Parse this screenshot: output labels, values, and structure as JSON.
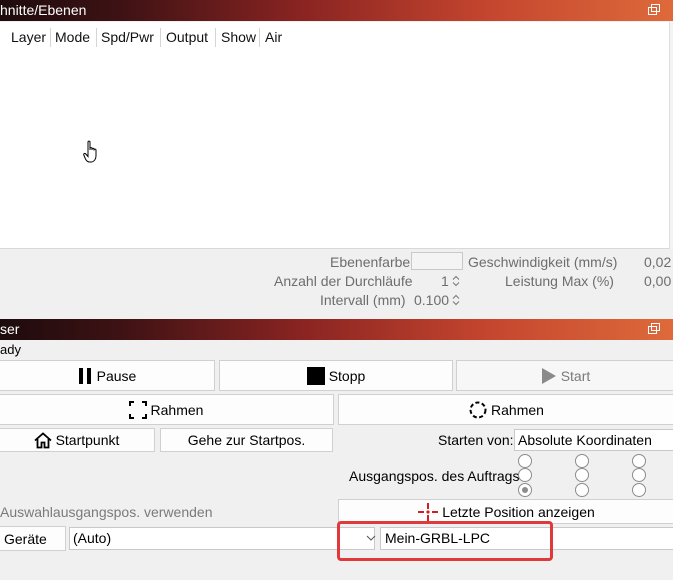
{
  "cuts_panel": {
    "title": "hnitte/Ebenen",
    "columns": [
      "Layer",
      "Mode",
      "Spd/Pwr",
      "Output",
      "Show",
      "Air"
    ],
    "layer_color_label": "Ebenenfarbe",
    "speed_label": "Geschwindigkeit (mm/s)",
    "speed_value": "0,02",
    "passes_label": "Anzahl der Durchläufe",
    "passes_value": "1",
    "power_label": "Leistung Max (%)",
    "power_value": "0,00",
    "interval_label": "Intervall (mm)",
    "interval_value": "0.100"
  },
  "laser_panel": {
    "title": "ser",
    "status": "ady",
    "pause_label": "Pause",
    "stop_label": "Stopp",
    "start_label": "Start",
    "frame_label_1": "Rahmen",
    "frame_label_2": "Rahmen",
    "home_label": "Startpunkt",
    "goto_origin_label": "Gehe zur Startpos.",
    "start_from_label": "Starten von:",
    "start_from_value": "Absolute Koordinaten",
    "job_origin_label": "Ausgangspos. des Auftrags",
    "use_selection_origin_label": "Auswahlausgangspos. verwenden",
    "show_last_position_label": "Letzte Position anzeigen",
    "devices_label": "Geräte",
    "port_value": "(Auto)",
    "device_value": "Mein-GRBL-LPC"
  },
  "colors": {
    "highlight": "#e0393b",
    "titlebar_start": "#1d0b0d",
    "titlebar_end": "#de6a3b"
  }
}
